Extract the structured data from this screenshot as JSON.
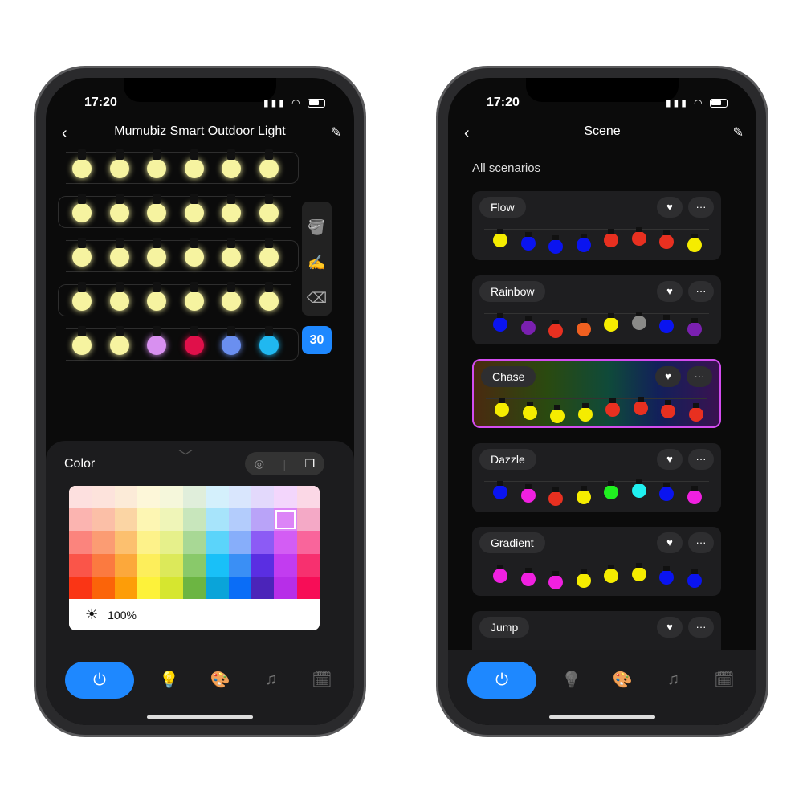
{
  "left": {
    "status": {
      "time": "17:20"
    },
    "header": {
      "title": "Mumubiz Smart Outdoor Light",
      "back_icon": "chevron-left-icon",
      "edit_icon": "pencil-icon"
    },
    "bulbs": [
      [
        "#f6f3a0",
        "#f6f3a0",
        "#f6f3a0",
        "#f6f3a0",
        "#f6f3a0",
        "#f6f3a0"
      ],
      [
        "#f6f3a0",
        "#f6f3a0",
        "#f6f3a0",
        "#f6f3a0",
        "#f6f3a0",
        "#f6f3a0"
      ],
      [
        "#f6f3a0",
        "#f6f3a0",
        "#f6f3a0",
        "#f6f3a0",
        "#f6f3a0",
        "#f6f3a0"
      ],
      [
        "#f6f3a0",
        "#f6f3a0",
        "#f6f3a0",
        "#f6f3a0",
        "#f6f3a0",
        "#f6f3a0"
      ],
      [
        "#f6f3a0",
        "#f6f3a0",
        "#d890f0",
        "#e0104a",
        "#6a8ff0",
        "#20b8f0"
      ]
    ],
    "tools": {
      "fill": "🪣",
      "draw": "✍",
      "erase": "⌫"
    },
    "count": "30",
    "panel": {
      "title": "Color",
      "brightness": "100%",
      "selected": "#dc84f7",
      "palette": [
        [
          "#fde0df",
          "#fde3dc",
          "#fcebd8",
          "#fdf7d9",
          "#f5f7db",
          "#e0eedb",
          "#d4f0fc",
          "#d9e6fd",
          "#e3d9fc",
          "#f3d6fc",
          "#fbd8e6"
        ],
        [
          "#fbb4b0",
          "#fbbfa7",
          "#fbd5a4",
          "#fdf6b3",
          "#eff5b8",
          "#c8e6bc",
          "#a7e4fb",
          "#b3ccfc",
          "#b9a3f8",
          "#dc84f7",
          "#f4a9c6"
        ],
        [
          "#fb847d",
          "#fb9c73",
          "#fcc06f",
          "#fdf28a",
          "#e6f08b",
          "#a8d895",
          "#5bd4fa",
          "#87aefa",
          "#8c5bf5",
          "#d35df4",
          "#f9659b"
        ],
        [
          "#fa5549",
          "#fb7a40",
          "#fca83b",
          "#fdee5b",
          "#dce95a",
          "#89c96a",
          "#19c0f8",
          "#3a8ff5",
          "#5a2ee2",
          "#c23cf0",
          "#f7306f"
        ],
        [
          "#fa3515",
          "#fb6409",
          "#fd9d08",
          "#fdf23a",
          "#d6e62f",
          "#6cb542",
          "#0aa4d9",
          "#0a6df7",
          "#4b24b9",
          "#b72ee8",
          "#f70d57"
        ]
      ]
    },
    "tabbar": {
      "active": "bulb"
    }
  },
  "right": {
    "status": {
      "time": "17:20"
    },
    "header": {
      "title": "Scene"
    },
    "section": "All scenarios",
    "scenes": [
      {
        "name": "Flow",
        "bulbs": [
          "#f5ec00",
          "#0a14f0",
          "#0a14f0",
          "#0a14f0",
          "#e83020",
          "#e83020",
          "#e83020",
          "#f5ec00"
        ]
      },
      {
        "name": "Rainbow",
        "bulbs": [
          "#0a14f0",
          "#7a20b0",
          "#e83020",
          "#f06020",
          "#f5ec00",
          "#8a8a88",
          "#0a14f0",
          "#7a20b0"
        ]
      },
      {
        "name": "Chase",
        "active": true,
        "bulbs": [
          "#f5ec00",
          "#f5ec00",
          "#f5ec00",
          "#f5ec00",
          "#e83020",
          "#e83020",
          "#e83020",
          "#e83020"
        ]
      },
      {
        "name": "Dazzle",
        "bulbs": [
          "#0a14f0",
          "#f020e0",
          "#e83020",
          "#f5ec00",
          "#20f020",
          "#20f0f0",
          "#0a14f0",
          "#f020e0"
        ]
      },
      {
        "name": "Gradient",
        "bulbs": [
          "#f020e0",
          "#f020e0",
          "#f020e0",
          "#f5ec00",
          "#f5ec00",
          "#f5ec00",
          "#0a14f0",
          "#0a14f0"
        ]
      },
      {
        "name": "Jump",
        "bulbs": []
      }
    ],
    "tabbar": {
      "active": "palette"
    }
  },
  "accent": "#1e88ff"
}
